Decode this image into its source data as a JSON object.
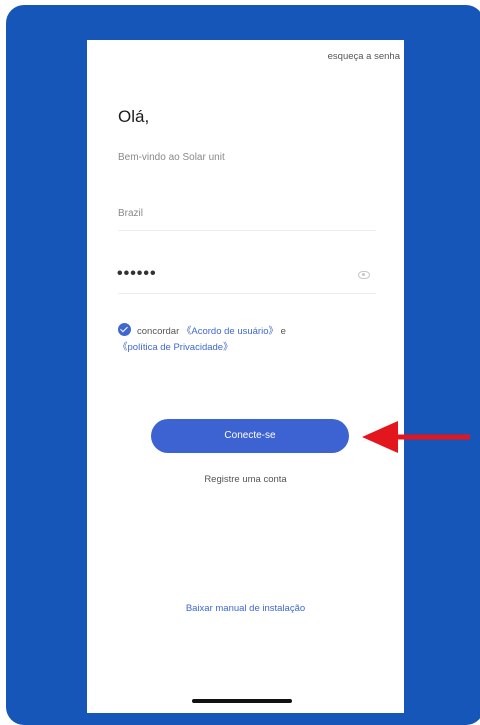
{
  "header": {
    "forgot_password": "esqueça a senha"
  },
  "login": {
    "greeting": "Olá,",
    "welcome": "Bem-vindo ao Solar unit",
    "country": "Brazil",
    "password_mask": "••••••"
  },
  "agreement": {
    "checked": true,
    "prefix": "concordar",
    "user_agreement": "《Acordo de usuário》",
    "conjunction": "e",
    "privacy_policy": "《política de Privacidade》"
  },
  "actions": {
    "connect_label": "Conecte-se",
    "register_label": "Registre uma conta",
    "manual_label": "Baixar manual de instalação"
  },
  "colors": {
    "frame_background": "#1656b8",
    "accent": "#3d63d2",
    "arrow": "#e3161e"
  },
  "icons": {
    "password_toggle": "eye-icon",
    "agreement_check": "check-icon",
    "pointer": "arrow-icon"
  }
}
